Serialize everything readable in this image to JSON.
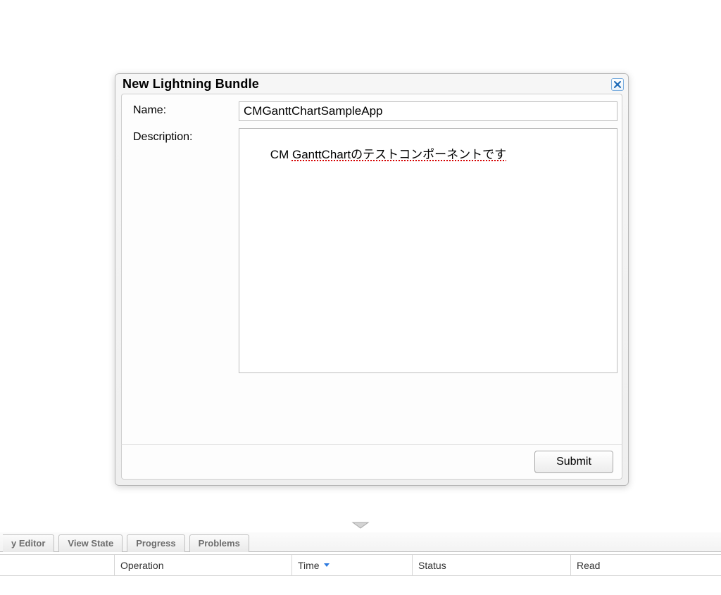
{
  "dialog": {
    "title": "New Lightning Bundle",
    "name_label": "Name:",
    "name_value": "CMGanttChartSampleApp",
    "desc_label": "Description:",
    "desc_prefix": "CM ",
    "desc_spellpart": "GanttChartのテストコンポーネントです",
    "submit_label": "Submit"
  },
  "panel": {
    "tabs": {
      "editor_partial": "y Editor",
      "view_state": "View State",
      "progress": "Progress",
      "problems": "Problems"
    },
    "columns": {
      "operation": "Operation",
      "time": "Time",
      "status": "Status",
      "read": "Read"
    }
  }
}
